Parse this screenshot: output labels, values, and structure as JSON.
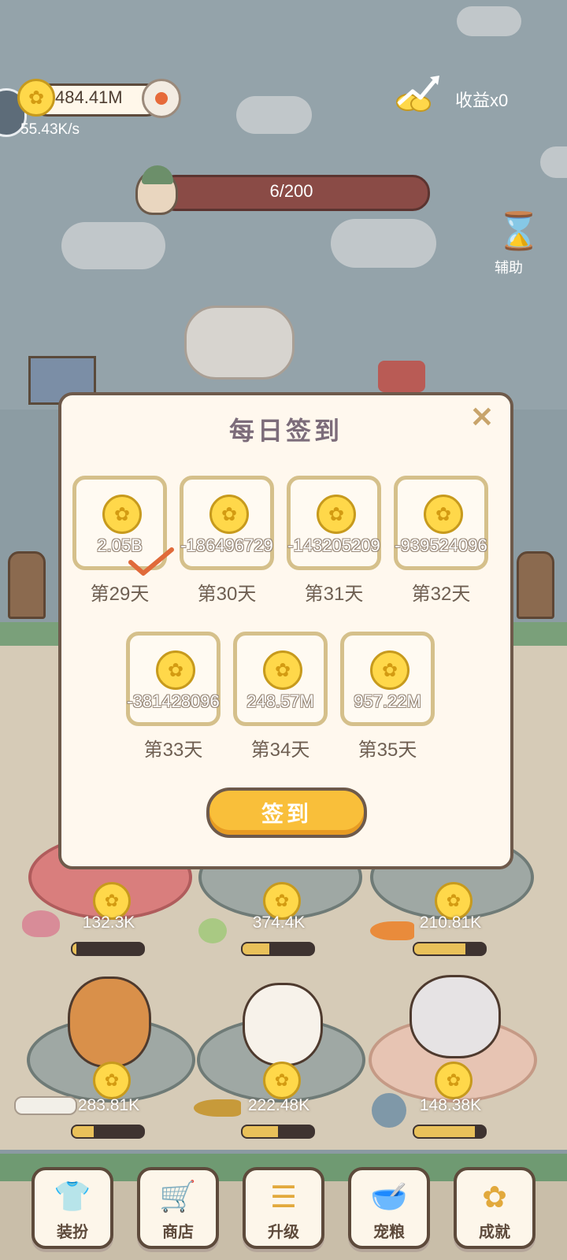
{
  "hud": {
    "coin_icon": "paw-coin-icon",
    "coins": "484.41M",
    "rate": "55.43K/s",
    "income_label": "收益x0",
    "progress": {
      "text": "6/200",
      "current": 6,
      "max": 200
    },
    "assist_label": "辅助"
  },
  "modal": {
    "title": "每日签到",
    "close_icon": "close-icon",
    "days": [
      {
        "amount": "2.05B",
        "label": "第29天",
        "checked": true
      },
      {
        "amount": "-186496729",
        "label": "第30天",
        "checked": false
      },
      {
        "amount": "-143205209",
        "label": "第31天",
        "checked": false
      },
      {
        "amount": "-939524096",
        "label": "第32天",
        "checked": false
      },
      {
        "amount": "-381428096",
        "label": "第33天",
        "checked": false
      },
      {
        "amount": "248.57M",
        "label": "第34天",
        "checked": false
      },
      {
        "amount": "957.22M",
        "label": "第35天",
        "checked": false
      }
    ],
    "sign_in_button": "签到"
  },
  "pets": [
    {
      "amount": "132.3K",
      "progress": 0.05
    },
    {
      "amount": "374.4K",
      "progress": 0.38
    },
    {
      "amount": "210.81K",
      "progress": 0.72
    },
    {
      "amount": "283.81K",
      "progress": 0.3
    },
    {
      "amount": "222.48K",
      "progress": 0.5
    },
    {
      "amount": "148.38K",
      "progress": 0.85
    }
  ],
  "nav": [
    {
      "label": "装扮",
      "icon": "shirt-icon"
    },
    {
      "label": "商店",
      "icon": "cart-icon"
    },
    {
      "label": "升级",
      "icon": "upgrade-icon"
    },
    {
      "label": "宠粮",
      "icon": "pet-food-icon"
    },
    {
      "label": "成就",
      "icon": "achievement-icon"
    }
  ],
  "colors": {
    "accent": "#f9bf3a",
    "card_border": "#d5c08b",
    "modal_border": "#6e5a4b",
    "progress_fill": "#e9c15a"
  }
}
